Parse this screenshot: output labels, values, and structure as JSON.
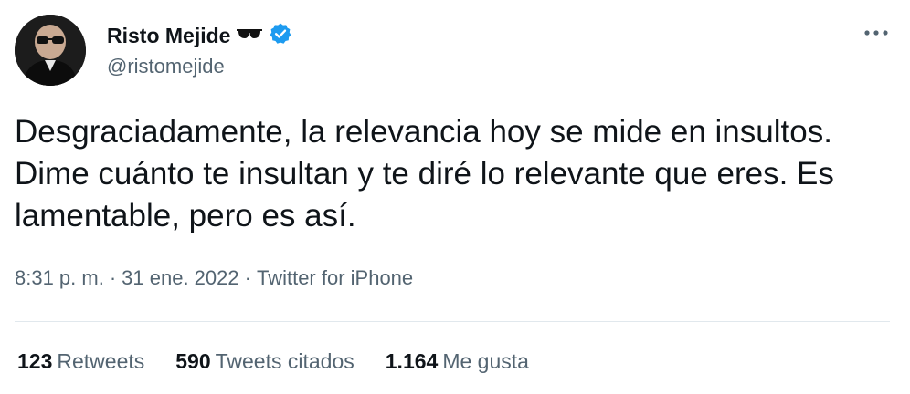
{
  "author": {
    "name": "Risto Mejide",
    "name_emoji": "sunglasses-icon",
    "verified": true,
    "handle": "@ristomejide"
  },
  "tweet": {
    "text": "Desgraciadamente, la relevancia hoy se mide en insultos. Dime cuánto te insultan y te diré lo relevante que eres. Es lamentable, pero es así."
  },
  "meta": {
    "time": "8:31 p. m.",
    "separator": "·",
    "date": "31 ene. 2022",
    "source": "Twitter for iPhone"
  },
  "stats": {
    "retweets_count": "123",
    "retweets_label": "Retweets",
    "quotes_count": "590",
    "quotes_label": "Tweets citados",
    "likes_count": "1.164",
    "likes_label": "Me gusta"
  },
  "colors": {
    "text": "#0f1419",
    "secondary": "#536471",
    "verified": "#1d9bf0",
    "divider": "#e1e8ed"
  }
}
